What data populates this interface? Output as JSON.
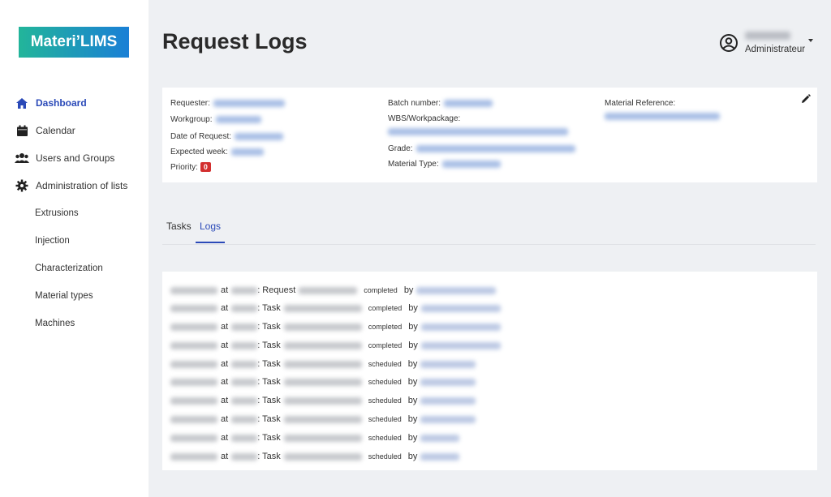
{
  "app": {
    "logo": "Materi’LIMS"
  },
  "sidebar": {
    "items": [
      {
        "label": "Dashboard",
        "icon": "home-icon",
        "active": true
      },
      {
        "label": "Calendar",
        "icon": "calendar-icon"
      },
      {
        "label": "Users and Groups",
        "icon": "users-icon"
      },
      {
        "label": "Administration of lists",
        "icon": "gear-icon"
      }
    ],
    "subitems": [
      {
        "label": "Extrusions"
      },
      {
        "label": "Injection"
      },
      {
        "label": "Characterization"
      },
      {
        "label": "Material types"
      },
      {
        "label": "Machines"
      }
    ]
  },
  "header": {
    "title": "Request Logs"
  },
  "user": {
    "role": "Administrateur"
  },
  "details": {
    "requester_label": "Requester:",
    "workgroup_label": "Workgroup:",
    "date_label": "Date of Request:",
    "week_label": "Expected week:",
    "priority_label": "Priority:",
    "priority_value": "0",
    "batch_label": "Batch number:",
    "wbs_label": "WBS/Workpackage:",
    "grade_label": "Grade:",
    "material_type_label": "Material Type:",
    "material_ref_label": "Material Reference:"
  },
  "tabs": [
    {
      "label": "Tasks",
      "active": false
    },
    {
      "label": "Logs",
      "active": true
    }
  ],
  "logs": {
    "at_word": "at",
    "by_word": "by",
    "rows": [
      {
        "kind": "Request",
        "status": "completed"
      },
      {
        "kind": "Task",
        "status": "completed"
      },
      {
        "kind": "Task",
        "status": "completed"
      },
      {
        "kind": "Task",
        "status": "completed"
      },
      {
        "kind": "Task",
        "status": "scheduled"
      },
      {
        "kind": "Task",
        "status": "scheduled"
      },
      {
        "kind": "Task",
        "status": "scheduled"
      },
      {
        "kind": "Task",
        "status": "scheduled"
      },
      {
        "kind": "Task",
        "status": "scheduled"
      },
      {
        "kind": "Task",
        "status": "scheduled"
      }
    ]
  },
  "colors": {
    "accent": "#2a49b8",
    "priority": "#d32f2f",
    "logo_start": "#22b59a",
    "logo_end": "#1a7fd6"
  }
}
